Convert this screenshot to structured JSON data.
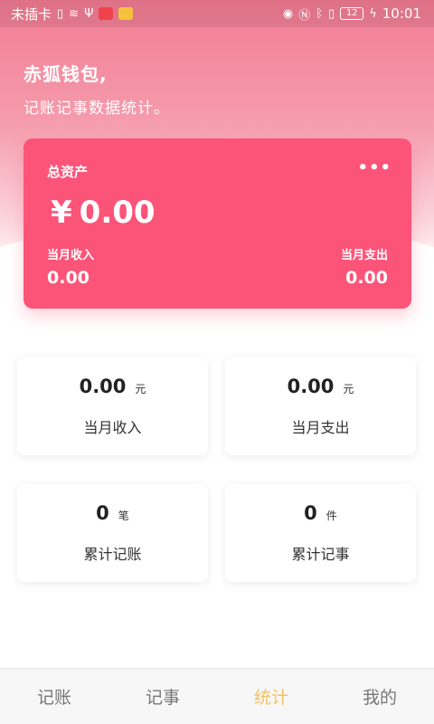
{
  "status_bar": {
    "carrier": "未插卡",
    "time": "10:01",
    "battery": "12"
  },
  "header": {
    "title": "赤狐钱包,",
    "subtitle": "记账记事数据统计。"
  },
  "asset_card": {
    "label": "总资产",
    "more": "•••",
    "currency": "¥",
    "amount": "0.00",
    "income_label": "当月收入",
    "income_value": "0.00",
    "expense_label": "当月支出",
    "expense_value": "0.00"
  },
  "stats": [
    {
      "value": "0.00",
      "unit": "元",
      "label": "当月收入"
    },
    {
      "value": "0.00",
      "unit": "元",
      "label": "当月支出"
    },
    {
      "value": "0",
      "unit": "笔",
      "label": "累计记账"
    },
    {
      "value": "0",
      "unit": "件",
      "label": "累计记事"
    }
  ],
  "tabs": [
    {
      "label": "记账"
    },
    {
      "label": "记事"
    },
    {
      "label": "统计"
    },
    {
      "label": "我的"
    }
  ],
  "colors": {
    "accent": "#fc5478",
    "active_tab": "#f5c063"
  }
}
